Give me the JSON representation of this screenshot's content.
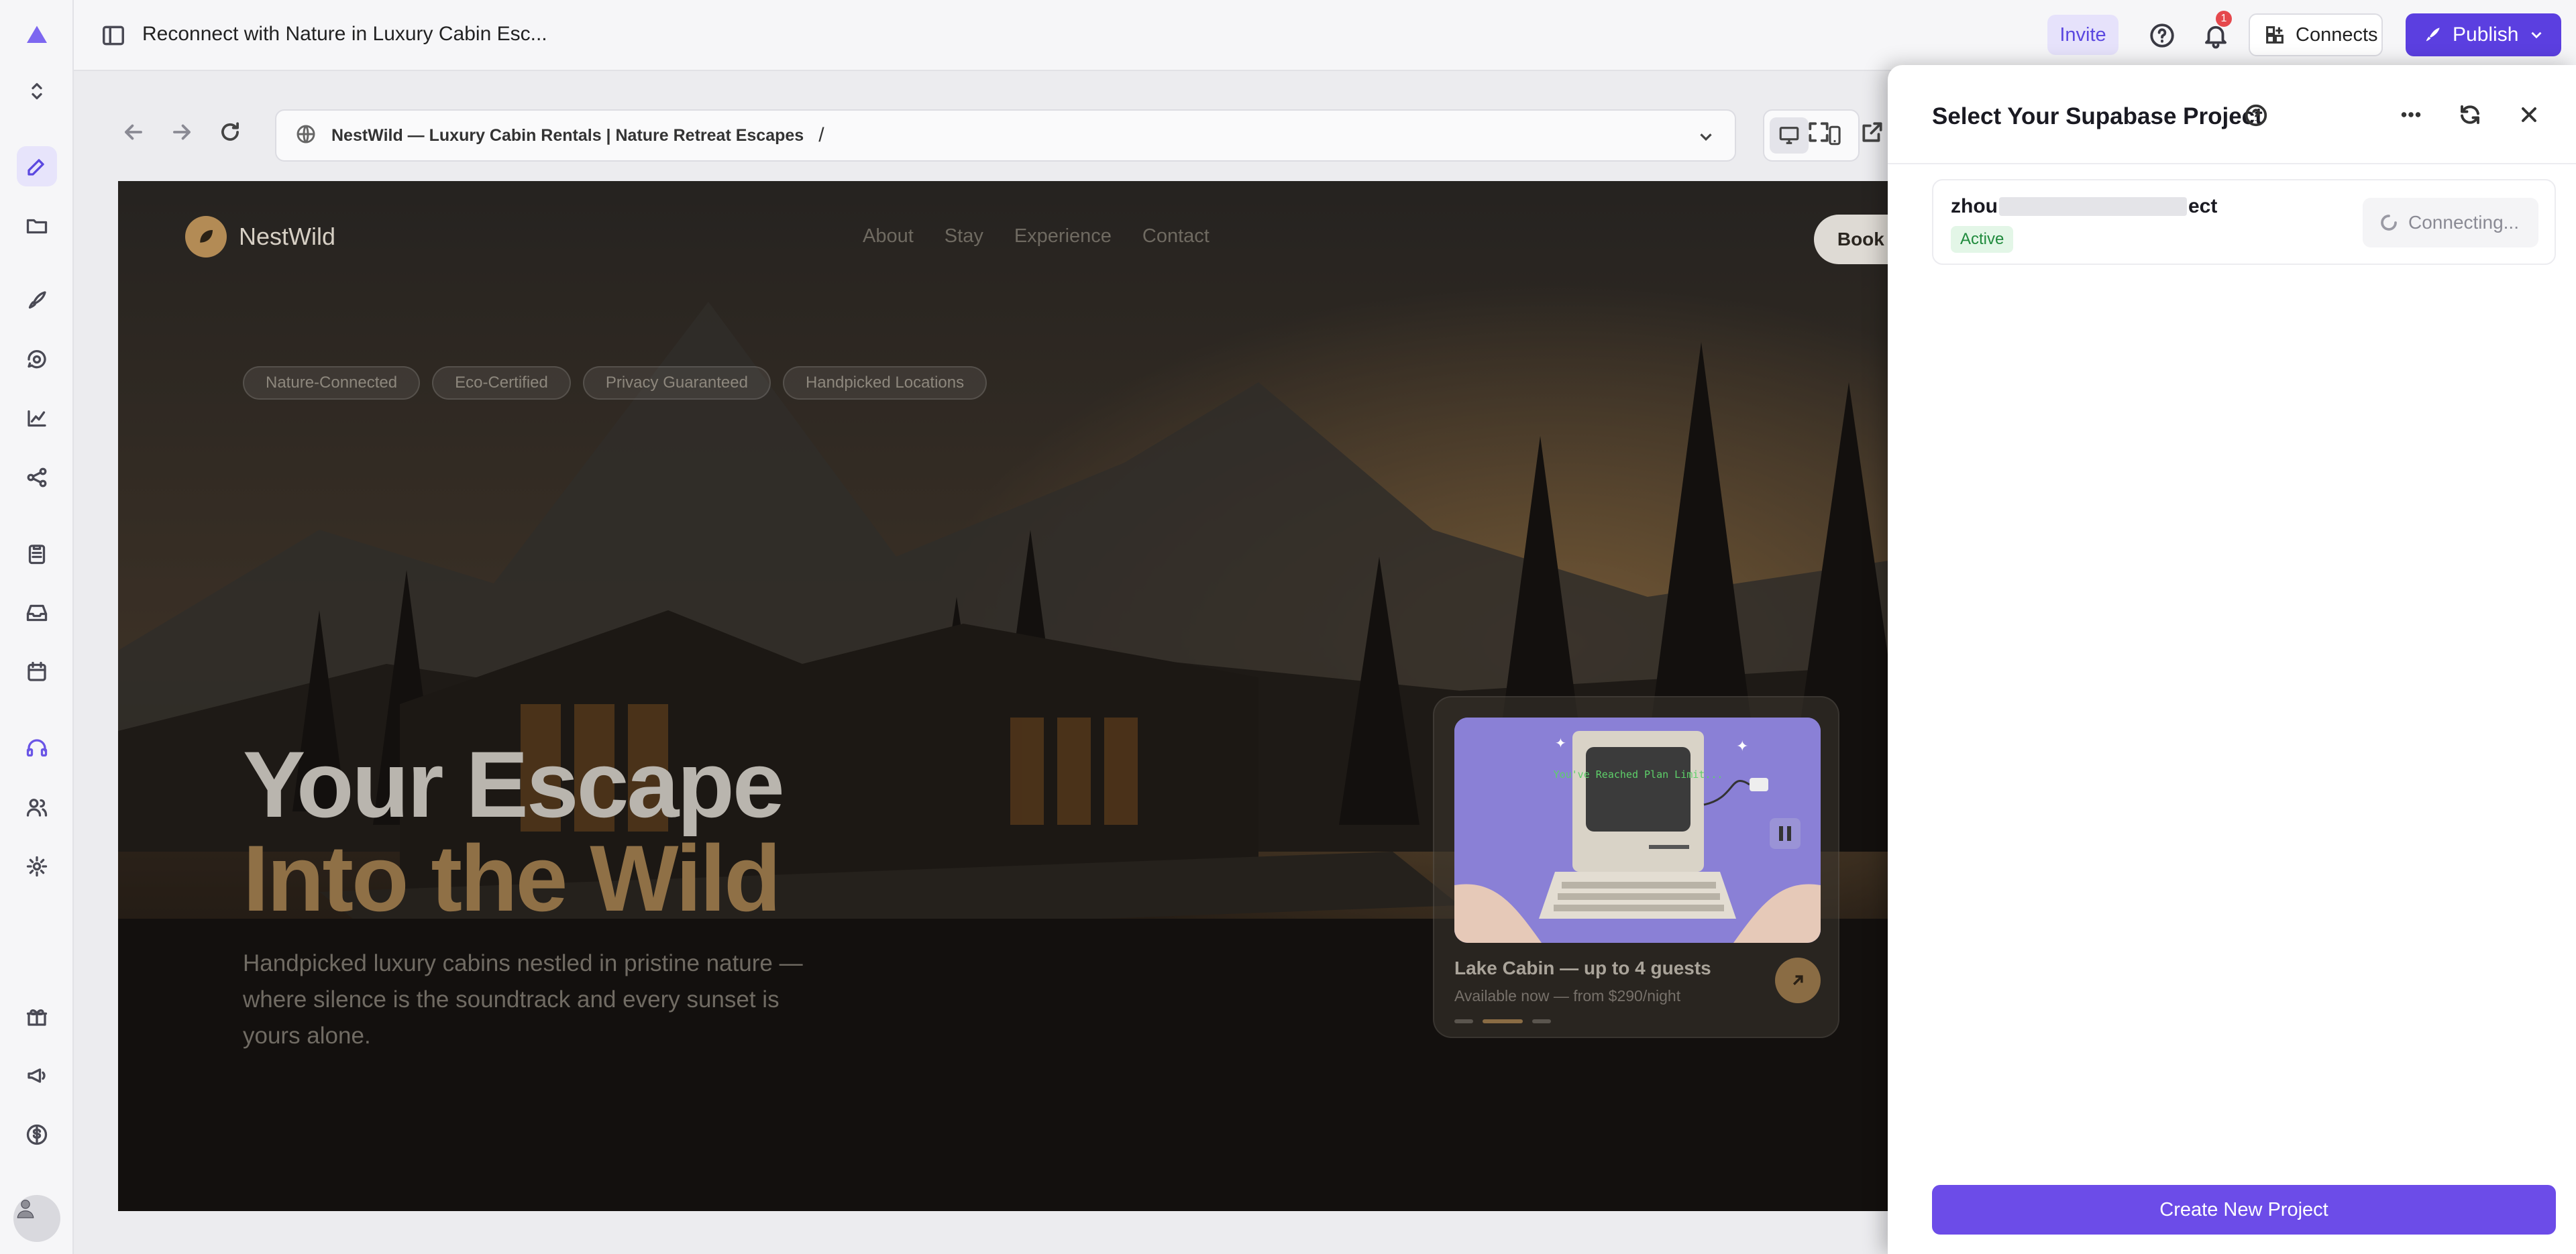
{
  "app": {
    "project_title": "Reconnect with Nature in Luxury Cabin Esc...",
    "invite_label": "Invite",
    "notification_count": "1",
    "connects_label": "Connects",
    "publish_label": "Publish"
  },
  "browser": {
    "address_title": "NestWild — Luxury Cabin Rentals | Nature Retreat Escapes",
    "address_path": "/"
  },
  "preview": {
    "brand_name": "NestWild",
    "nav_links": [
      "About",
      "Stay",
      "Experience",
      "Contact"
    ],
    "book_button": "Book a Stay",
    "tags": [
      "Nature-Connected",
      "Eco-Certified",
      "Privacy Guaranteed",
      "Handpicked Locations"
    ],
    "headline_line1": "Your Escape",
    "headline_line2": "Into the Wild",
    "subheadline": "Handpicked luxury cabins nestled in pristine nature — where silence is the soundtrack and every sunset is yours alone.",
    "card": {
      "title": "Lake Cabin — up to 4 guests",
      "subtitle": "Available now — from $290/night",
      "screen_text": "You've Reached Plan Limit..."
    }
  },
  "supabase_panel": {
    "title": "Select Your Supabase Project",
    "project": {
      "name_start": "zhou",
      "name_end": "ect",
      "status": "Active",
      "connect_label": "Connecting..."
    },
    "create_button": "Create New Project"
  },
  "colors": {
    "accent": "#5b3fe0",
    "create_button": "#6c4ce8",
    "status_green": "#1f8a3c",
    "brand_gold": "#8f7046"
  }
}
